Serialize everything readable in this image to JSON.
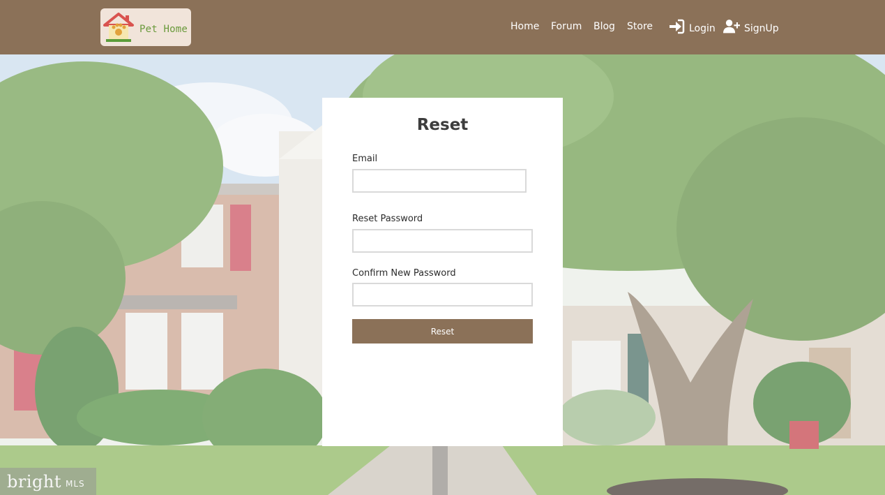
{
  "header": {
    "logo_text": "Pet Home",
    "nav": {
      "home": "Home",
      "forum": "Forum",
      "blog": "Blog",
      "store": "Store",
      "login": "Login",
      "signup": "SignUp"
    },
    "icons": {
      "login": "sign-in-icon",
      "signup": "user-plus-icon"
    }
  },
  "form": {
    "title": "Reset",
    "email_label": "Email",
    "email_value": "",
    "reset_password_label": "Reset Password",
    "reset_password_value": "",
    "confirm_password_label": "Confirm New Password",
    "confirm_password_value": "",
    "submit_label": "Reset"
  },
  "watermark": {
    "brand": "bright",
    "suffix": "MLS"
  },
  "colors": {
    "header_bg": "#8b7158",
    "button_bg": "#8b7158",
    "card_bg": "#ffffff",
    "logo_bg": "#f1e4da"
  }
}
